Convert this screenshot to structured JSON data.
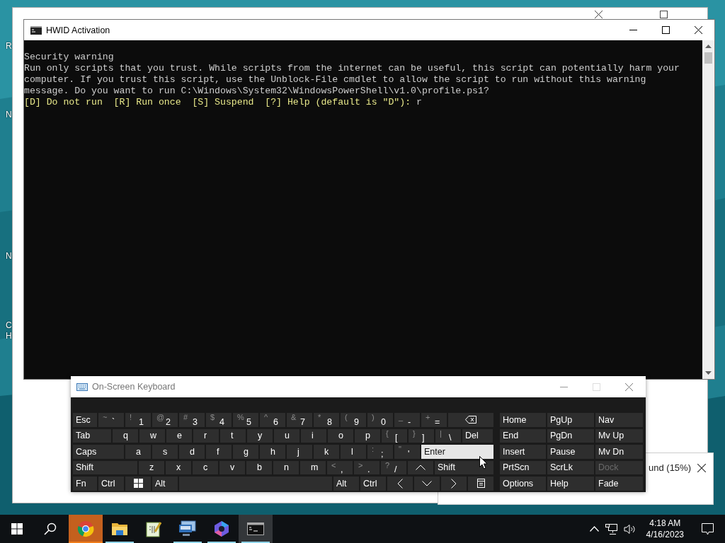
{
  "desktop": {
    "icon_labels": [
      "R",
      "N",
      "N",
      "C",
      "H"
    ]
  },
  "console": {
    "title": "HWID Activation",
    "lines": [
      {
        "kind": "text",
        "text": "Security warning"
      },
      {
        "kind": "text",
        "text": "Run only scripts that you trust. While scripts from the internet can be useful, this script can potentially harm your"
      },
      {
        "kind": "text",
        "text": "computer. If you trust this script, use the Unblock-File cmdlet to allow the script to run without this warning"
      },
      {
        "kind": "text",
        "text": "message. Do you want to run C:\\Windows\\System32\\WindowsPowerShell\\v1.0\\profile.ps1?"
      },
      {
        "kind": "prompt",
        "text": "[D] Do not run  [R] Run once  [S] Suspend  [?] Help (default is \"D\"): ",
        "input": "r"
      }
    ]
  },
  "notification": {
    "text": "und (15%)"
  },
  "keyboard": {
    "title": "On-Screen Keyboard",
    "rows": [
      [
        {
          "kind": "text",
          "label": "Esc",
          "hovered": false
        },
        {
          "kind": "char",
          "shift": "~",
          "label": "`",
          "hovered": false
        },
        {
          "kind": "char",
          "shift": "!",
          "label": "1",
          "hovered": false
        },
        {
          "kind": "char",
          "shift": "@",
          "label": "2",
          "hovered": false
        },
        {
          "kind": "char",
          "shift": "#",
          "label": "3",
          "hovered": false
        },
        {
          "kind": "char",
          "shift": "$",
          "label": "4",
          "hovered": false
        },
        {
          "kind": "char",
          "shift": "%",
          "label": "5",
          "hovered": false
        },
        {
          "kind": "char",
          "shift": "^",
          "label": "6",
          "hovered": false
        },
        {
          "kind": "char",
          "shift": "&",
          "label": "7",
          "hovered": false
        },
        {
          "kind": "char",
          "shift": "*",
          "label": "8",
          "hovered": false
        },
        {
          "kind": "char",
          "shift": "(",
          "label": "9",
          "hovered": false
        },
        {
          "kind": "char",
          "shift": ")",
          "label": "0",
          "hovered": false
        },
        {
          "kind": "char",
          "shift": "_",
          "label": "-",
          "hovered": false
        },
        {
          "kind": "char",
          "shift": "+",
          "label": "=",
          "hovered": false
        },
        {
          "kind": "backspace",
          "hovered": false
        }
      ],
      [
        {
          "kind": "text",
          "label": "Tab",
          "hovered": false
        },
        {
          "kind": "char",
          "label": "q",
          "hovered": false
        },
        {
          "kind": "char",
          "label": "w",
          "hovered": false
        },
        {
          "kind": "char",
          "label": "e",
          "hovered": false
        },
        {
          "kind": "char",
          "label": "r",
          "hovered": false
        },
        {
          "kind": "char",
          "label": "t",
          "hovered": false
        },
        {
          "kind": "char",
          "label": "y",
          "hovered": false
        },
        {
          "kind": "char",
          "label": "u",
          "hovered": false
        },
        {
          "kind": "char",
          "label": "i",
          "hovered": false
        },
        {
          "kind": "char",
          "label": "o",
          "hovered": false
        },
        {
          "kind": "char",
          "label": "p",
          "hovered": false
        },
        {
          "kind": "char",
          "shift": "{",
          "label": "[",
          "hovered": false
        },
        {
          "kind": "char",
          "shift": "}",
          "label": "]",
          "hovered": false
        },
        {
          "kind": "char",
          "shift": "|",
          "label": "\\",
          "hovered": false
        },
        {
          "kind": "text",
          "label": "Del",
          "hovered": false
        }
      ],
      [
        {
          "kind": "text",
          "label": "Caps",
          "hovered": false
        },
        {
          "kind": "char",
          "label": "a",
          "hovered": false
        },
        {
          "kind": "char",
          "label": "s",
          "hovered": false
        },
        {
          "kind": "char",
          "label": "d",
          "hovered": false
        },
        {
          "kind": "char",
          "label": "f",
          "hovered": false
        },
        {
          "kind": "char",
          "label": "g",
          "hovered": false
        },
        {
          "kind": "char",
          "label": "h",
          "hovered": false
        },
        {
          "kind": "char",
          "label": "j",
          "hovered": false
        },
        {
          "kind": "char",
          "label": "k",
          "hovered": false
        },
        {
          "kind": "char",
          "label": "l",
          "hovered": false
        },
        {
          "kind": "char",
          "shift": ":",
          "label": ";",
          "hovered": false
        },
        {
          "kind": "char",
          "shift": "\"",
          "label": "'",
          "hovered": false
        },
        {
          "kind": "text",
          "label": "Enter",
          "hovered": true
        }
      ],
      [
        {
          "kind": "text",
          "label": "Shift",
          "hovered": false
        },
        {
          "kind": "char",
          "label": "z",
          "hovered": false
        },
        {
          "kind": "char",
          "label": "x",
          "hovered": false
        },
        {
          "kind": "char",
          "label": "c",
          "hovered": false
        },
        {
          "kind": "char",
          "label": "v",
          "hovered": false
        },
        {
          "kind": "char",
          "label": "b",
          "hovered": false
        },
        {
          "kind": "char",
          "label": "n",
          "hovered": false
        },
        {
          "kind": "char",
          "label": "m",
          "hovered": false
        },
        {
          "kind": "char",
          "shift": "<",
          "label": ",",
          "hovered": false
        },
        {
          "kind": "char",
          "shift": ">",
          "label": ".",
          "hovered": false
        },
        {
          "kind": "char",
          "shift": "?",
          "label": "/",
          "hovered": false
        },
        {
          "kind": "up",
          "hovered": false
        },
        {
          "kind": "text",
          "label": "Shift",
          "hovered": false
        }
      ],
      [
        {
          "kind": "text",
          "label": "Fn",
          "hovered": false
        },
        {
          "kind": "text",
          "label": "Ctrl",
          "hovered": false
        },
        {
          "kind": "windows",
          "hovered": false
        },
        {
          "kind": "text",
          "label": "Alt",
          "hovered": false
        },
        {
          "kind": "space",
          "hovered": false
        },
        {
          "kind": "text",
          "label": "Alt",
          "hovered": false
        },
        {
          "kind": "text",
          "label": "Ctrl",
          "hovered": false
        },
        {
          "kind": "left",
          "hovered": false
        },
        {
          "kind": "down",
          "hovered": false
        },
        {
          "kind": "right",
          "hovered": false
        },
        {
          "kind": "menu",
          "hovered": false
        }
      ]
    ],
    "nav_keys": [
      {
        "label": "Home",
        "disabled": false
      },
      {
        "label": "PgUp",
        "disabled": false
      },
      {
        "label": "Nav",
        "disabled": false
      },
      {
        "label": "End",
        "disabled": false
      },
      {
        "label": "PgDn",
        "disabled": false
      },
      {
        "label": "Mv Up",
        "disabled": false
      },
      {
        "label": "Insert",
        "disabled": false
      },
      {
        "label": "Pause",
        "disabled": false
      },
      {
        "label": "Mv Dn",
        "disabled": false
      },
      {
        "label": "PrtScn",
        "disabled": false
      },
      {
        "label": "ScrLk",
        "disabled": false
      },
      {
        "label": "Dock",
        "disabled": true
      },
      {
        "label": "Options",
        "disabled": false
      },
      {
        "label": "Help",
        "disabled": false
      },
      {
        "label": "Fade",
        "disabled": false
      }
    ]
  },
  "taskbar": {
    "apps": [
      {
        "kind": "browser",
        "running": false,
        "flashing": true,
        "active": false
      },
      {
        "kind": "folder",
        "running": true,
        "flashing": false,
        "active": false
      },
      {
        "kind": "notepad",
        "running": false,
        "flashing": false,
        "active": false
      },
      {
        "kind": "remote",
        "running": true,
        "flashing": false,
        "active": false
      },
      {
        "kind": "copilot",
        "running": true,
        "flashing": false,
        "active": false
      },
      {
        "kind": "console",
        "running": true,
        "flashing": false,
        "active": true
      }
    ],
    "time": "4:18 AM",
    "date": "4/16/2023"
  }
}
